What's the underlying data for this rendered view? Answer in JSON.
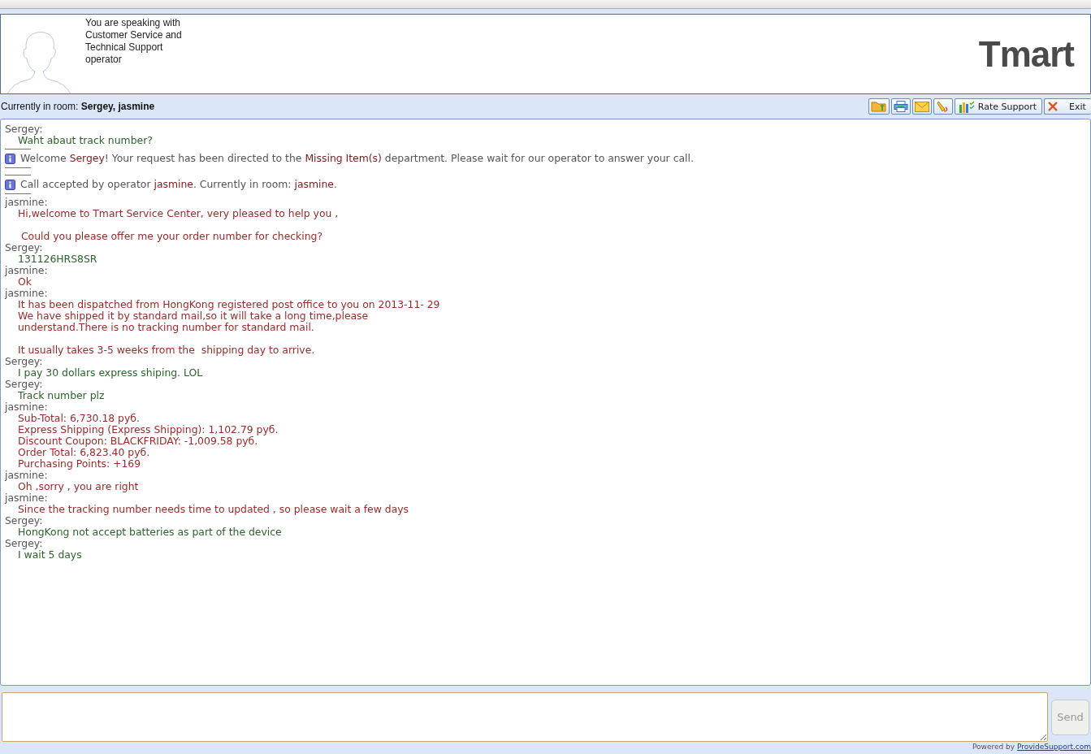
{
  "header": {
    "intro": "You are speaking with Customer Service and Technical Support operator",
    "logo": "Tmart"
  },
  "room_bar": {
    "text": "Currently in room: **Sergey, jasmine**",
    "toolbar": [
      {
        "kind": "upload"
      },
      {
        "kind": "print"
      },
      {
        "kind": "email"
      },
      {
        "kind": "sound"
      },
      {
        "kind": "rate",
        "label": "Rate Support"
      },
      {
        "kind": "exit",
        "label": "Exit"
      }
    ]
  },
  "transcript": [
    {
      "kind": "message",
      "speaker": "Sergey:",
      "color": "#2c622c",
      "lines": [
        {
          "text": "Waht abaut track number?",
          "gap_before": false
        }
      ]
    },
    {
      "kind": "system",
      "parts": [
        {
          "text": "Welcome ",
          "highlight": false
        },
        {
          "text": "Sergey",
          "highlight": true
        },
        {
          "text": "! Your request has been directed to the ",
          "highlight": false
        },
        {
          "text": "Missing Item(s)",
          "highlight": true
        },
        {
          "text": " department. Please wait for our operator to answer your call.",
          "highlight": false
        }
      ]
    },
    {
      "kind": "system",
      "parts": [
        {
          "text": "Call accepted by operator ",
          "highlight": false
        },
        {
          "text": "jasmine",
          "highlight": true
        },
        {
          "text": ". Currently in room: ",
          "highlight": false
        },
        {
          "text": "jasmine",
          "highlight": true
        },
        {
          "text": ".",
          "highlight": false
        }
      ]
    },
    {
      "kind": "message",
      "speaker": "jasmine:",
      "color": "#9c2a2a",
      "lines": [
        {
          "text": "Hi,welcome to Tmart Service Center, very pleased to help you ,",
          "gap_before": false
        },
        {
          "text": " Could you please offer me your order number for checking?",
          "gap_before": true
        }
      ]
    },
    {
      "kind": "message",
      "speaker": "Sergey:",
      "color": "#2c622c",
      "lines": [
        {
          "text": "131126HRS8SR",
          "gap_before": false
        }
      ]
    },
    {
      "kind": "message",
      "speaker": "jasmine:",
      "color": "#9c2a2a",
      "lines": [
        {
          "text": "Ok",
          "gap_before": false
        }
      ]
    },
    {
      "kind": "message",
      "speaker": "jasmine:",
      "color": "#9c2a2a",
      "lines": [
        {
          "text": "It has been dispatched from HongKong registered post office to you on 2013-11- 29",
          "gap_before": false
        },
        {
          "text": "We have shipped it by standard mail,so it will take a long time,please",
          "gap_before": false
        },
        {
          "text": "understand.There is no tracking number for standard mail.",
          "gap_before": false
        },
        {
          "text": "It usually takes 3-5 weeks from the  shipping day to arrive.",
          "gap_before": true
        }
      ]
    },
    {
      "kind": "message",
      "speaker": "Sergey:",
      "color": "#2c622c",
      "lines": [
        {
          "text": "I pay 30 dollars express shiping. LOL",
          "gap_before": false
        }
      ]
    },
    {
      "kind": "message",
      "speaker": "Sergey:",
      "color": "#2c622c",
      "lines": [
        {
          "text": "Track number plz",
          "gap_before": false
        }
      ]
    },
    {
      "kind": "message",
      "speaker": "jasmine:",
      "color": "#9c2a2a",
      "lines": [
        {
          "text": "Sub-Total: 6,730.18 руб.",
          "gap_before": false
        },
        {
          "text": "Express Shipping (Express Shipping): 1,102.79 руб.",
          "gap_before": false
        },
        {
          "text": "Discount Coupon: BLACKFRIDAY: -1,009.58 руб.",
          "gap_before": false
        },
        {
          "text": "Order Total: 6,823.40 руб.",
          "gap_before": false
        },
        {
          "text": "Purchasing Points: +169",
          "gap_before": false
        }
      ]
    },
    {
      "kind": "message",
      "speaker": "jasmine:",
      "color": "#9c2a2a",
      "lines": [
        {
          "text": "Oh ,sorry , you are right",
          "gap_before": false
        }
      ]
    },
    {
      "kind": "message",
      "speaker": "jasmine:",
      "color": "#9c2a2a",
      "lines": [
        {
          "text": "Since the tracking number needs time to updated , so please wait a few days",
          "gap_before": false
        }
      ]
    },
    {
      "kind": "message",
      "speaker": "Sergey:",
      "color": "#2c622c",
      "lines": [
        {
          "text": "HongKong not accept batteries as part of the device",
          "gap_before": false
        }
      ]
    },
    {
      "kind": "message",
      "speaker": "Sergey:",
      "color": "#2c622c",
      "lines": [
        {
          "text": "I wait 5 days",
          "gap_before": false
        }
      ]
    }
  ],
  "composer": {
    "send": {
      "label": "Send",
      "disabled": true
    }
  },
  "footer": {
    "prefix": "Powered by ",
    "link": "ProvideSupport.com"
  }
}
